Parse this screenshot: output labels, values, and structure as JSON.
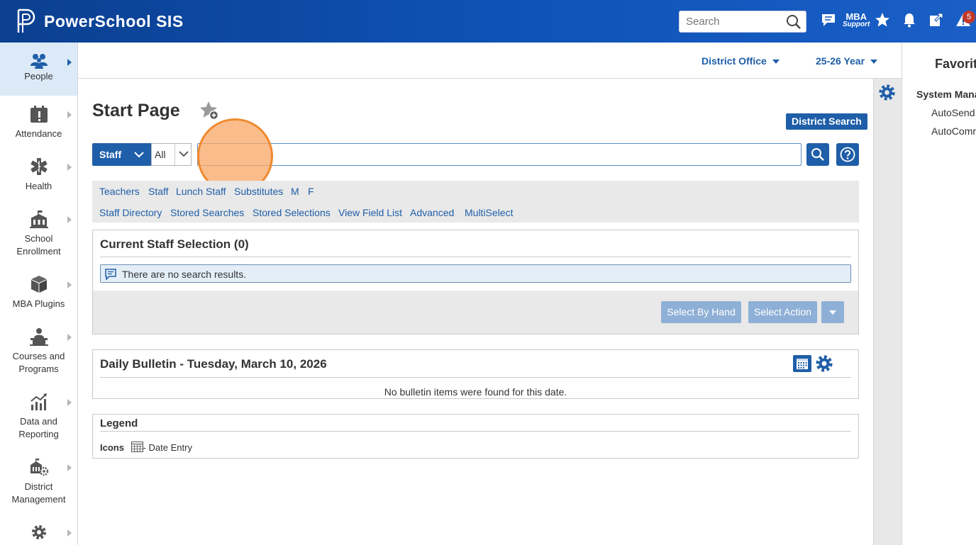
{
  "header": {
    "brand": "PowerSchool SIS",
    "search_placeholder": "Search",
    "mba_line1": "MBA",
    "mba_line2": "Support",
    "alert_count": "5"
  },
  "sidebar": {
    "items": [
      {
        "label": "People",
        "icon": "people-icon",
        "active": true
      },
      {
        "label": "Attendance",
        "icon": "attendance-icon"
      },
      {
        "label": "Health",
        "icon": "health-icon"
      },
      {
        "label": "School Enrollment",
        "icon": "school-icon"
      },
      {
        "label": "MBA Plugins",
        "icon": "plugin-icon"
      },
      {
        "label": "Courses and Programs",
        "icon": "courses-icon"
      },
      {
        "label": "Data and Reporting",
        "icon": "chart-icon"
      },
      {
        "label": "District Management",
        "icon": "district-icon"
      },
      {
        "label": "",
        "icon": "gear-icon"
      }
    ]
  },
  "subheader": {
    "school": "District Office",
    "term": "25-26 Year"
  },
  "favorites": {
    "title": "Favorit",
    "section": "System Mana",
    "links": [
      "AutoSend",
      "AutoComm"
    ]
  },
  "main": {
    "title": "Start Page",
    "district_search": "District Search",
    "search_type": "Staff",
    "search_scope": "All",
    "search_value": "",
    "quicklinks_row1": [
      "Teachers",
      "Staff",
      "Lunch Staff",
      "Substitutes",
      "M",
      "F"
    ],
    "quicklinks_row2": [
      "Staff Directory",
      "Stored Searches",
      "Stored Selections",
      "View Field List",
      "Advanced",
      "MultiSelect"
    ]
  },
  "selection": {
    "title": "Current Staff Selection (0)",
    "notice": "There are no search results.",
    "select_by_hand": "Select By Hand",
    "select_action": "Select Action"
  },
  "bulletin": {
    "title": "Daily Bulletin - Tuesday, March 10, 2026",
    "empty": "No bulletin items were found for this date."
  },
  "legend": {
    "title": "Legend",
    "icons_label": "Icons",
    "date_entry": "- Date Entry"
  },
  "colors": {
    "accent": "#1f5ea8",
    "header": "#0f53b8",
    "disabled_button": "#8fb0d6",
    "click_highlight": "#f08a2e"
  }
}
